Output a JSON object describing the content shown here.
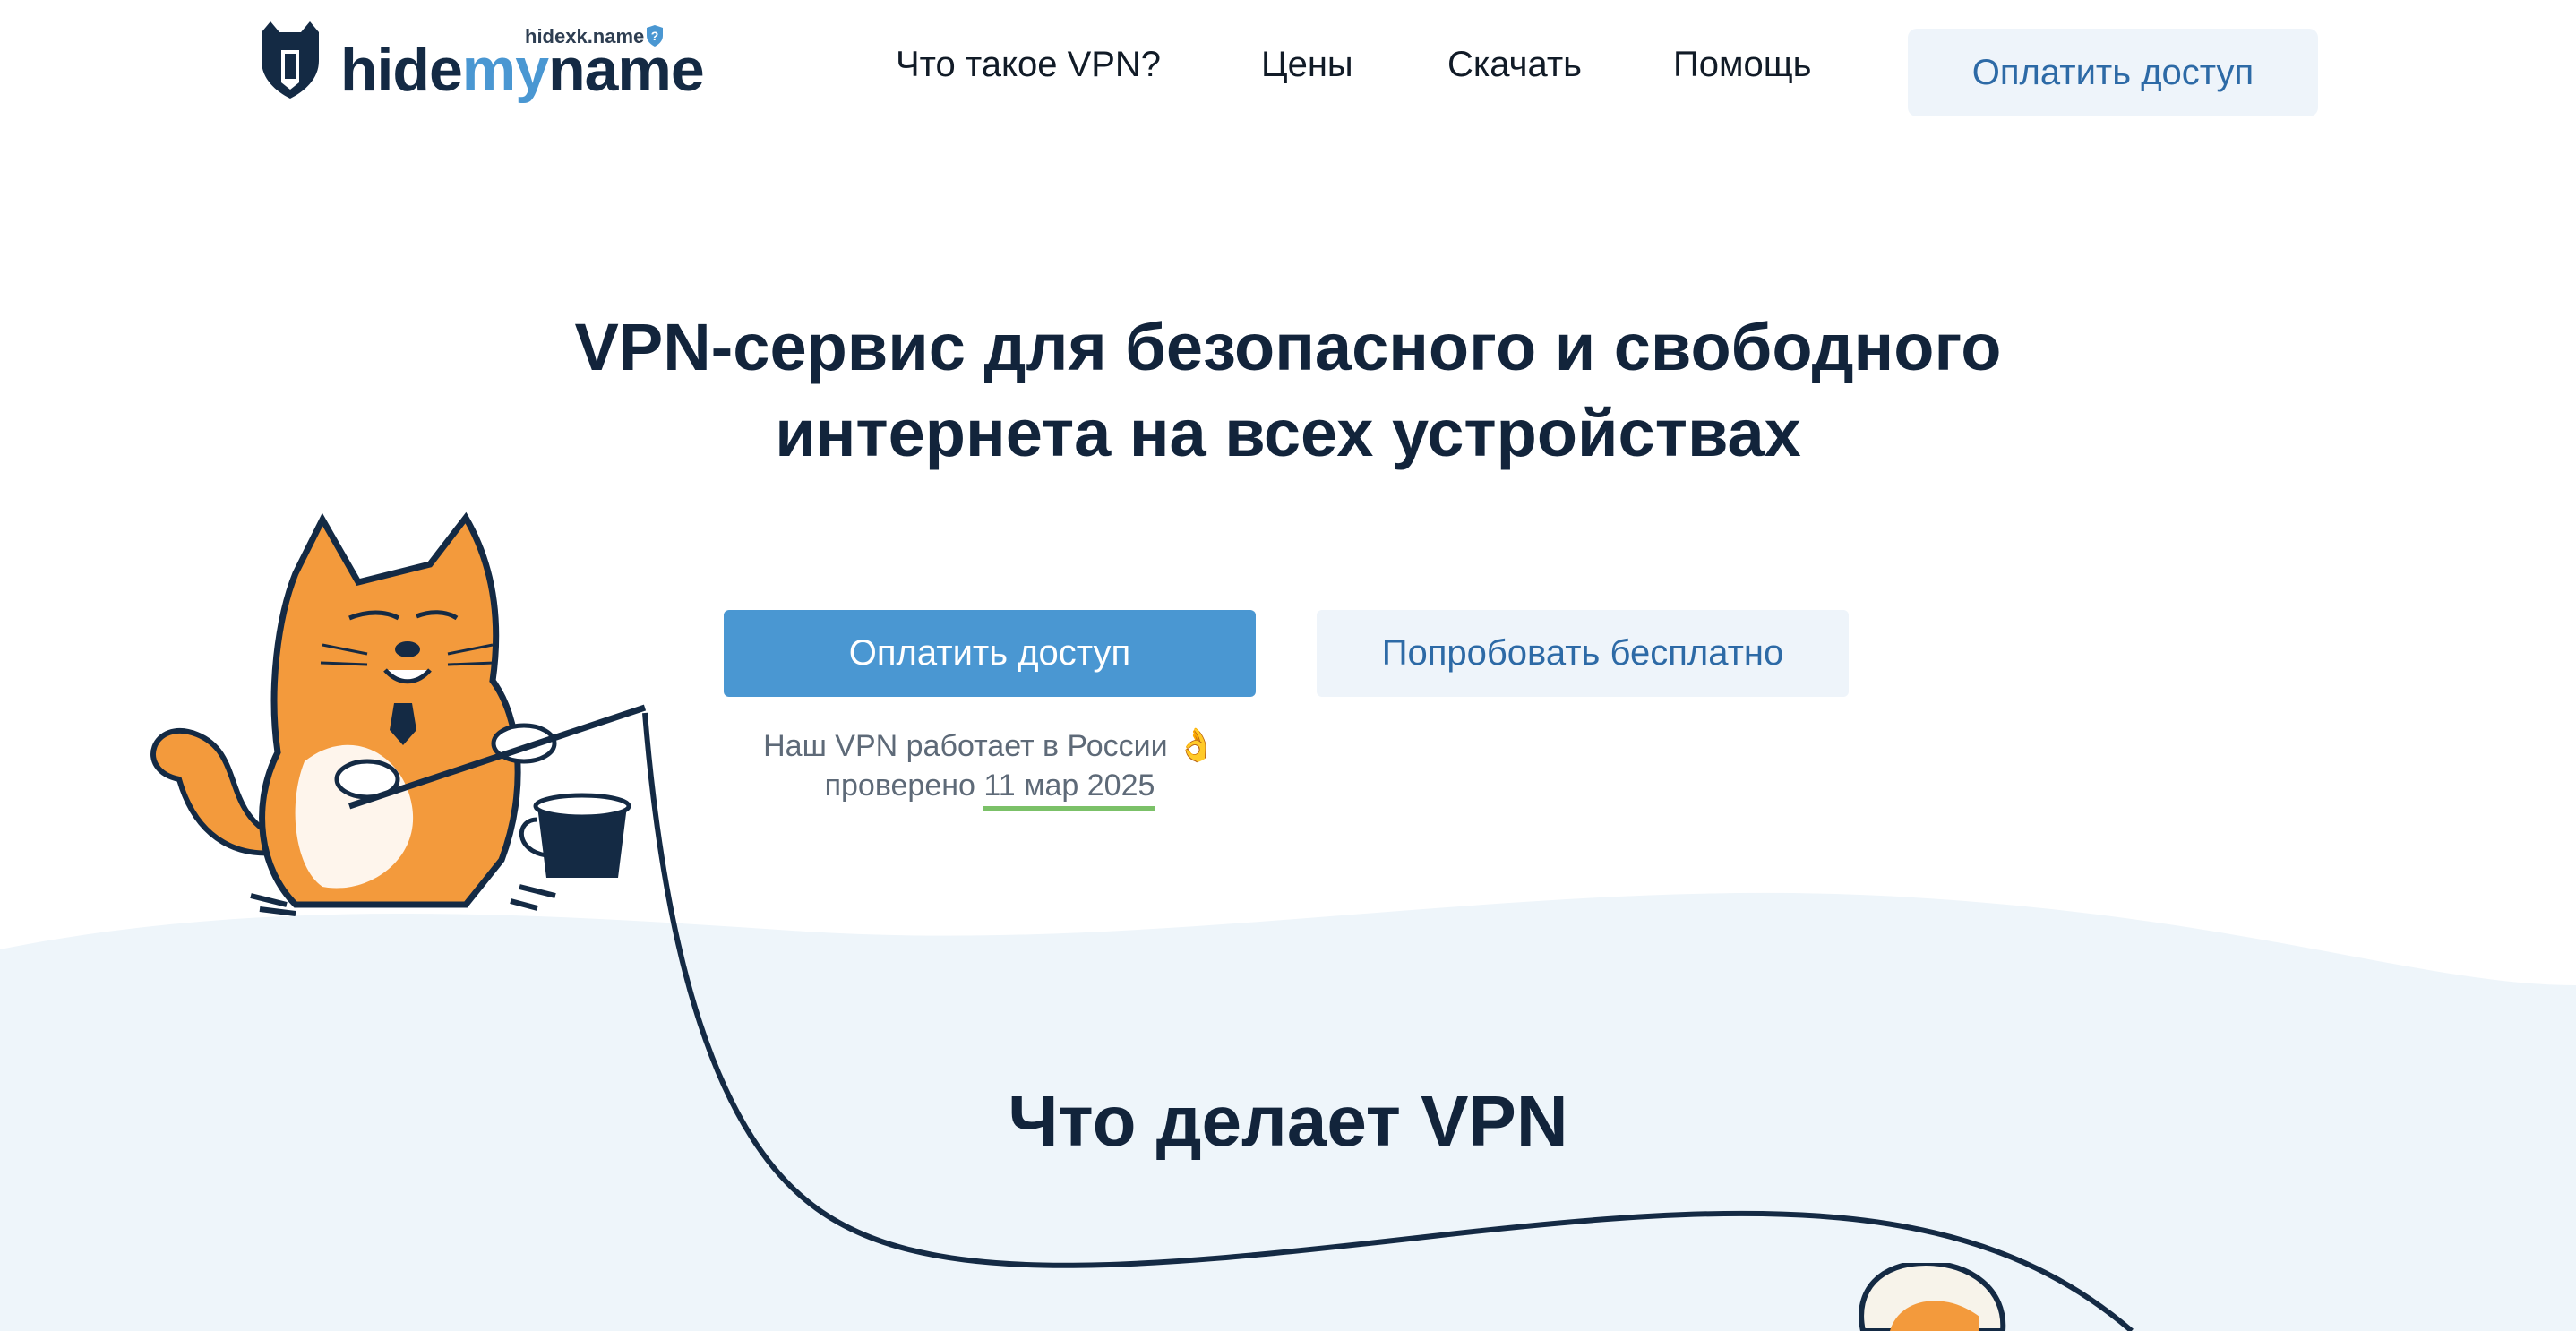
{
  "header": {
    "logo": {
      "brand_prefix": "hide",
      "brand_highlight": "my",
      "brand_suffix": "name",
      "domain": "hidexk.name",
      "help_badge": "?"
    },
    "nav": {
      "what_is_vpn": "Что такое VPN?",
      "prices": "Цены",
      "download": "Скачать",
      "help": "Помощь"
    },
    "pay_button": "Оплатить доступ"
  },
  "hero": {
    "title_line1": "VPN-сервис для безопасного и свободного",
    "title_line2": "интернета на всех устройствах",
    "pay_button": "Оплатить доступ",
    "trial_button": "Попробовать бесплатно",
    "status_text": "Наш VPN работает в России",
    "status_emoji": "👌",
    "checked_label": "проверено",
    "checked_date": "11 мар 2025"
  },
  "section": {
    "title": "Что делает VPN"
  },
  "colors": {
    "accent": "#4a97d2",
    "dark_text": "#12243b",
    "light_button": "#eef4fa",
    "link_blue": "#2d6aa6",
    "check_underline": "#7bc168",
    "section_bg": "#eef5fa",
    "cat_orange": "#f39a3c"
  },
  "icons": {
    "logo": "cat-shield-logo-icon",
    "help_badge": "shield-question-icon",
    "status": "ok-hand-emoji-icon"
  }
}
